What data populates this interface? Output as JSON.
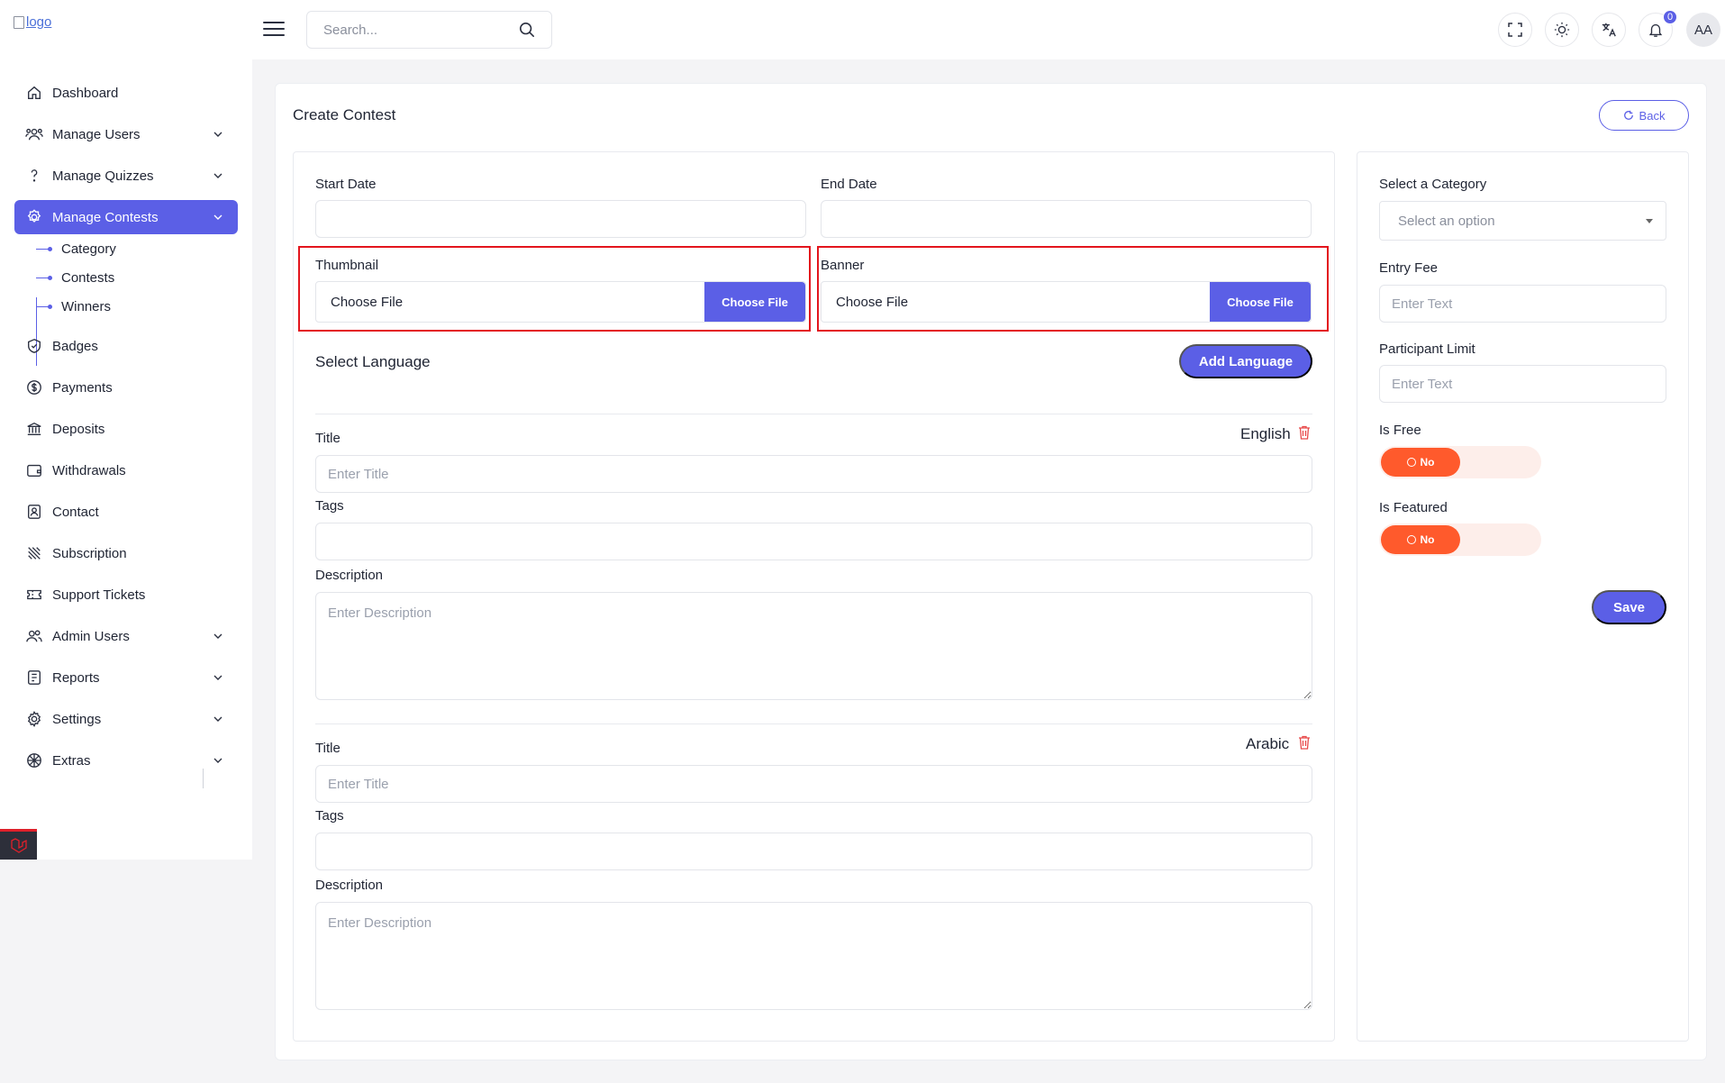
{
  "header": {
    "logo_alt": "logo",
    "search_placeholder": "Search...",
    "notification_count": "0",
    "avatar_initials": "AA"
  },
  "sidebar": {
    "items": [
      {
        "label": "Dashboard",
        "icon": "home-icon"
      },
      {
        "label": "Manage Users",
        "icon": "users-icon",
        "expandable": true
      },
      {
        "label": "Manage Quizzes",
        "icon": "question-icon",
        "expandable": true
      },
      {
        "label": "Manage Contests",
        "icon": "contest-icon",
        "expandable": true,
        "active": true
      },
      {
        "label": "Badges",
        "icon": "badge-icon"
      },
      {
        "label": "Payments",
        "icon": "dollar-icon"
      },
      {
        "label": "Deposits",
        "icon": "bank-icon"
      },
      {
        "label": "Withdrawals",
        "icon": "wallet-icon"
      },
      {
        "label": "Contact",
        "icon": "contact-icon"
      },
      {
        "label": "Subscription",
        "icon": "subscription-icon"
      },
      {
        "label": "Support Tickets",
        "icon": "ticket-icon"
      },
      {
        "label": "Admin Users",
        "icon": "admin-users-icon",
        "expandable": true
      },
      {
        "label": "Reports",
        "icon": "reports-icon",
        "expandable": true
      },
      {
        "label": "Settings",
        "icon": "gear-icon",
        "expandable": true
      },
      {
        "label": "Extras",
        "icon": "extras-icon",
        "expandable": true
      }
    ],
    "subitems": [
      "Category",
      "Contests",
      "Winners"
    ]
  },
  "page": {
    "title": "Create Contest",
    "back_label": "Back"
  },
  "form": {
    "start_date_label": "Start Date",
    "end_date_label": "End Date",
    "thumbnail_label": "Thumbnail",
    "banner_label": "Banner",
    "choose_file_text": "Choose File",
    "choose_file_button": "Choose File",
    "select_language_title": "Select Language",
    "add_language_button": "Add Language",
    "languages": [
      {
        "name": "English",
        "title_label": "Title",
        "title_placeholder": "Enter Title",
        "tags_label": "Tags",
        "description_label": "Description",
        "description_placeholder": "Enter Description"
      },
      {
        "name": "Arabic",
        "title_label": "Title",
        "title_placeholder": "Enter Title",
        "tags_label": "Tags",
        "description_label": "Description",
        "description_placeholder": "Enter Description"
      }
    ]
  },
  "side_form": {
    "category_label": "Select a Category",
    "category_placeholder": "Select an option",
    "entry_fee_label": "Entry Fee",
    "entry_fee_placeholder": "Enter Text",
    "participant_limit_label": "Participant Limit",
    "participant_limit_placeholder": "Enter Text",
    "is_free_label": "Is Free",
    "is_free_value": "No",
    "is_featured_label": "Is Featured",
    "is_featured_value": "No",
    "save_label": "Save"
  },
  "colors": {
    "accent": "#5b5fe6",
    "toggle_off": "#ff5a2c",
    "highlight": "#e3151d"
  }
}
